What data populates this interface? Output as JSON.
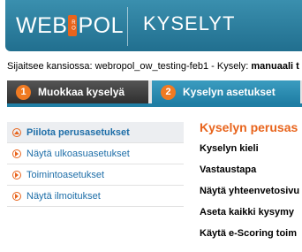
{
  "header": {
    "logo_left": "WEB",
    "logo_mark": "RO",
    "logo_right": "POL",
    "title": "KYSELYT"
  },
  "breadcrumb": {
    "prefix": "Sijaitsee kansiossa: webropol_ow_testing-feb1 - Kysely: ",
    "survey": "manuaali t"
  },
  "tabs": [
    {
      "number": "1",
      "label": "Muokkaa kyselyä"
    },
    {
      "number": "2",
      "label": "Kyselyn asetukset"
    }
  ],
  "sidebar": {
    "items": [
      {
        "label": "Piilota perusasetukset"
      },
      {
        "label": "Näytä ulkoasuasetukset"
      },
      {
        "label": "Toimintoasetukset"
      },
      {
        "label": "Näytä ilmoitukset"
      }
    ]
  },
  "main": {
    "title": "Kyselyn perusas",
    "settings": [
      {
        "label": "Kyselyn kieli"
      },
      {
        "label": "Vastaustapa"
      },
      {
        "label": "Näytä yhteenvetosivu"
      },
      {
        "label": "Aseta kaikki kysymy"
      },
      {
        "label": "Käytä e-Scoring toim"
      }
    ]
  },
  "colors": {
    "header_blue": "#216f8f",
    "accent_orange": "#e8641c",
    "active_tab_blue": "#1f7ea4",
    "link_blue": "#1e6ea8"
  }
}
